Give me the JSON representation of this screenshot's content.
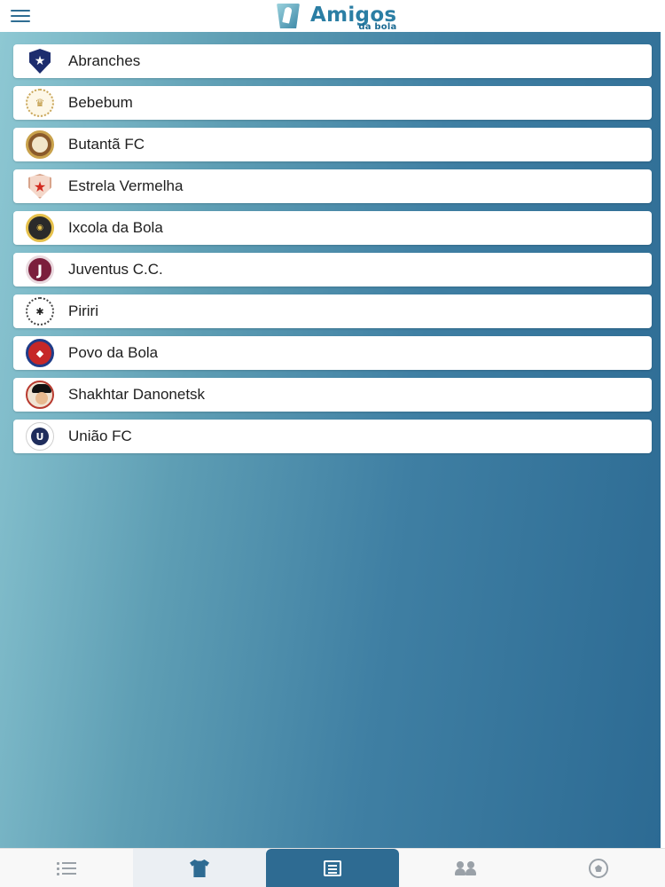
{
  "app": {
    "logo_title": "Amigos",
    "logo_subtitle": "da bola",
    "menu_icon": "hamburger-menu-icon",
    "logo_icon": "amigos-da-bola-logo-icon"
  },
  "teams": [
    {
      "name": "Abranches",
      "crest": "abranches-crest-icon"
    },
    {
      "name": "Bebebum",
      "crest": "bebebum-crest-icon"
    },
    {
      "name": "Butantã FC",
      "crest": "butanta-fc-crest-icon"
    },
    {
      "name": "Estrela Vermelha",
      "crest": "estrela-vermelha-crest-icon"
    },
    {
      "name": "Ixcola da Bola",
      "crest": "ixcola-da-bola-crest-icon"
    },
    {
      "name": "Juventus C.C.",
      "crest": "juventus-cc-crest-icon"
    },
    {
      "name": "Piriri",
      "crest": "piriri-crest-icon"
    },
    {
      "name": "Povo da Bola",
      "crest": "povo-da-bola-crest-icon"
    },
    {
      "name": "Shakhtar Danonetsk",
      "crest": "shakhtar-danonetsk-crest-icon"
    },
    {
      "name": "União FC",
      "crest": "uniao-fc-crest-icon"
    }
  ],
  "tabbar": {
    "tabs": [
      {
        "icon": "list-icon",
        "state": "inactive"
      },
      {
        "icon": "shirt-icon",
        "state": "highlighted"
      },
      {
        "icon": "newspaper-icon",
        "state": "active"
      },
      {
        "icon": "people-icon",
        "state": "inactive"
      },
      {
        "icon": "soccer-ball-icon",
        "state": "inactive"
      }
    ]
  },
  "colors": {
    "brand": "#2b7ea4",
    "active_tab": "#2e6b92",
    "background_gradient_start": "#8ec8d3",
    "background_gradient_end": "#2c6a93"
  }
}
